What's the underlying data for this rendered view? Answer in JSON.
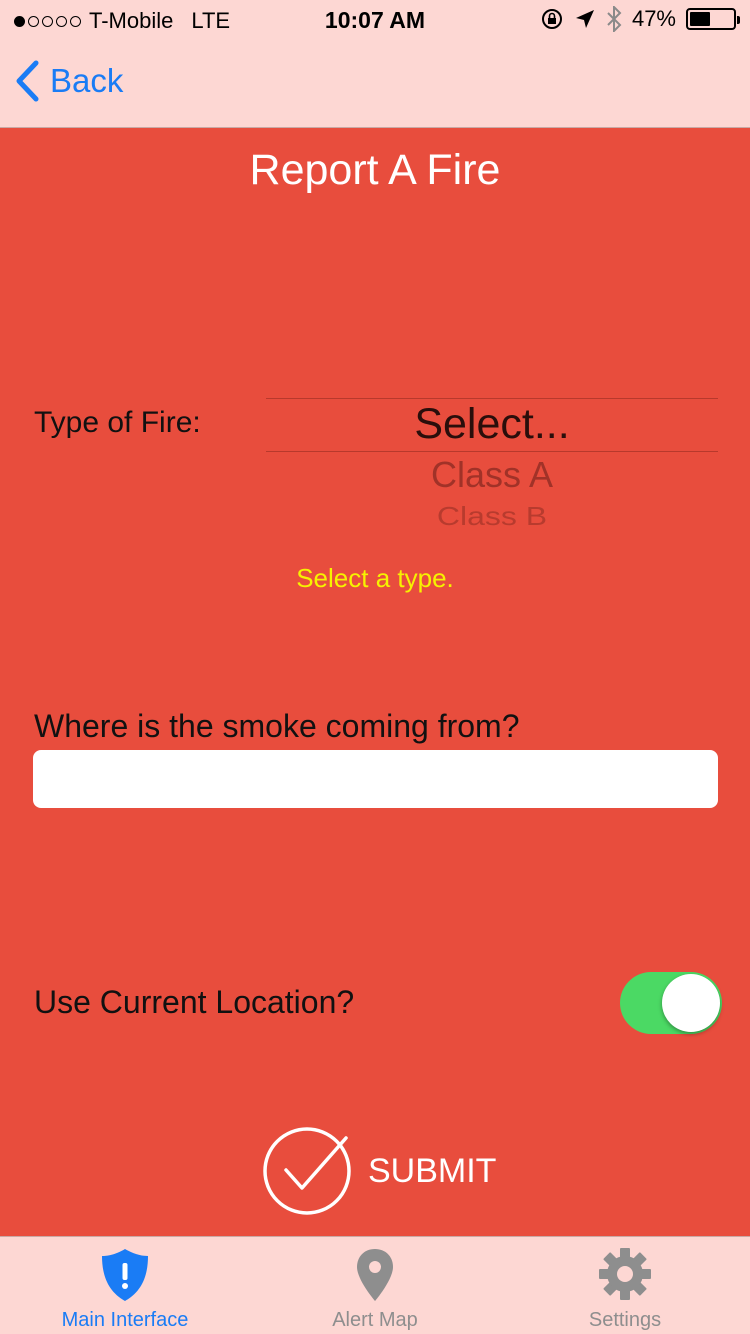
{
  "status_bar": {
    "carrier": "T-Mobile",
    "network": "LTE",
    "time": "10:07 AM",
    "battery": "47%",
    "battery_level": 0.47,
    "signal_bars_filled": 1,
    "signal_bars_total": 5
  },
  "nav": {
    "back_label": "Back",
    "accent_color": "#1a7cf5"
  },
  "main": {
    "title": "Report A Fire",
    "type_label": "Type of Fire:",
    "picker": {
      "selected": "Select...",
      "options": [
        "Class A",
        "Class B"
      ]
    },
    "hint": "Select a type.",
    "smoke_label": "Where is the smoke coming from?",
    "smoke_value": "",
    "location_label": "Use Current Location?",
    "location_enabled": true,
    "submit_label": "SUBMIT",
    "background_color": "#e84d3d"
  },
  "tabs": [
    {
      "label": "Main Interface",
      "icon": "shield-alert-icon",
      "active": true
    },
    {
      "label": "Alert Map",
      "icon": "map-pin-icon",
      "active": false
    },
    {
      "label": "Settings",
      "icon": "gear-icon",
      "active": false
    }
  ]
}
